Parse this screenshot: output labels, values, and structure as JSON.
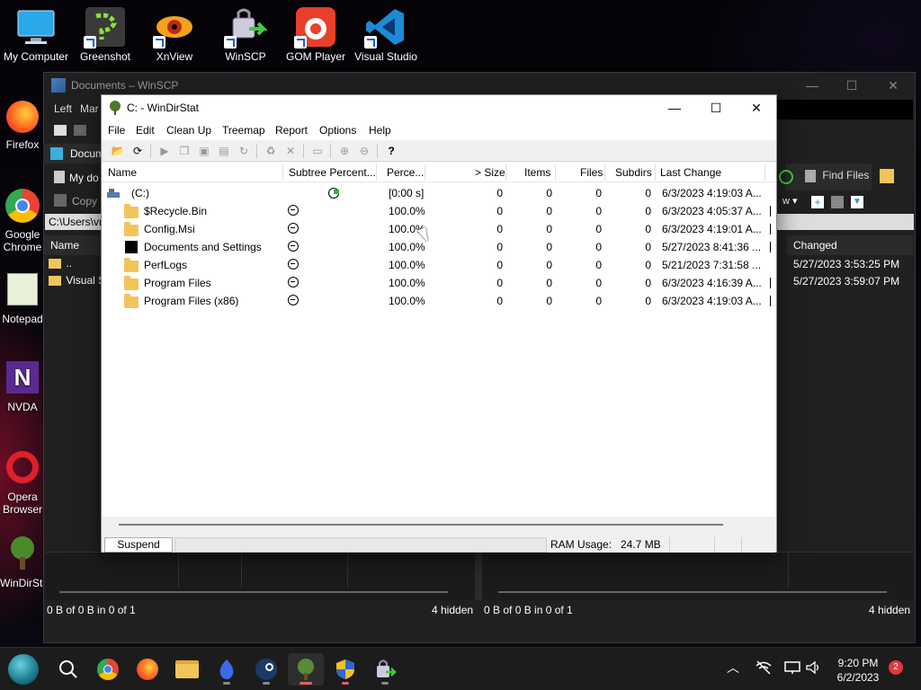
{
  "desktop": {
    "icons": [
      {
        "label": "My Computer"
      },
      {
        "label": "Greenshot"
      },
      {
        "label": "XnView"
      },
      {
        "label": "WinSCP"
      },
      {
        "label": "GOM Player"
      },
      {
        "label": "Visual Studio Code"
      }
    ],
    "side_icons": [
      {
        "label": "Firefox"
      },
      {
        "label": "Google Chrome"
      },
      {
        "label": "Notepad"
      },
      {
        "label": "NVDA"
      },
      {
        "label": "Opera Browser"
      },
      {
        "label": "WinDirStat"
      }
    ]
  },
  "winscp": {
    "title": "Documents – WinSCP",
    "menu_left": "Left",
    "menu_mark": "Mar",
    "tab": "Docum",
    "my_documents": "My do",
    "copy": "Copy",
    "path": "C:\\Users\\vr",
    "left_col_name": "Name",
    "left_rows": [
      "..",
      "Visual S"
    ],
    "find_files": "Find Files",
    "right_col_changed": "Changed",
    "right_rows": [
      "5/27/2023 3:53:25 PM",
      "5/27/2023 3:59:07 PM"
    ],
    "status_left": "0 B of 0 B in 0 of 1",
    "status_left_hidden": "4 hidden",
    "status_right": "0 B of 0 B in 0 of 1",
    "status_right_hidden": "4 hidden"
  },
  "windirstat": {
    "title": "C: - WinDirStat",
    "menu": [
      "File",
      "Edit",
      "Clean Up",
      "Treemap",
      "Report",
      "Options",
      "Help"
    ],
    "columns": {
      "name": "Name",
      "subtree": "Subtree Percent...",
      "percent": "Perce...",
      "size": "> Size",
      "items": "Items",
      "files": "Files",
      "subdirs": "Subdirs",
      "last_change": "Last Change"
    },
    "root": {
      "name": "(C:)",
      "percent": "[0:00 s]",
      "size": "0",
      "items": "0",
      "files": "0",
      "subdirs": "0",
      "last_change": "6/3/2023 4:19:03 A..."
    },
    "rows": [
      {
        "name": "$Recycle.Bin",
        "percent": "100.0%",
        "size": "0",
        "items": "0",
        "files": "0",
        "subdirs": "0",
        "last_change": "6/3/2023 4:05:37 A...",
        "icon": "folder-icon"
      },
      {
        "name": "Config.Msi",
        "percent": "100.0%",
        "size": "0",
        "items": "0",
        "files": "0",
        "subdirs": "0",
        "last_change": "6/3/2023 4:19:01 A...",
        "icon": "folder-icon"
      },
      {
        "name": "Documents and Settings",
        "percent": "100.0%",
        "size": "0",
        "items": "0",
        "files": "0",
        "subdirs": "0",
        "last_change": "5/27/2023 8:41:36 ...",
        "icon": "junction-icon"
      },
      {
        "name": "PerfLogs",
        "percent": "100.0%",
        "size": "0",
        "items": "0",
        "files": "0",
        "subdirs": "0",
        "last_change": "5/21/2023 7:31:58 ...",
        "icon": "folder-icon"
      },
      {
        "name": "Program Files",
        "percent": "100.0%",
        "size": "0",
        "items": "0",
        "files": "0",
        "subdirs": "0",
        "last_change": "6/3/2023 4:16:39 A...",
        "icon": "folder-icon"
      },
      {
        "name": "Program Files (x86)",
        "percent": "100.0%",
        "size": "0",
        "items": "0",
        "files": "0",
        "subdirs": "0",
        "last_change": "6/3/2023 4:19:03 A...",
        "icon": "folder-icon"
      }
    ],
    "status": {
      "suspend": "Suspend",
      "ram_label": "RAM Usage:",
      "ram_value": "24.7 MB"
    }
  },
  "taskbar": {
    "clock_time": "9:20 PM",
    "clock_date": "6/2/2023",
    "notifications": "2"
  }
}
